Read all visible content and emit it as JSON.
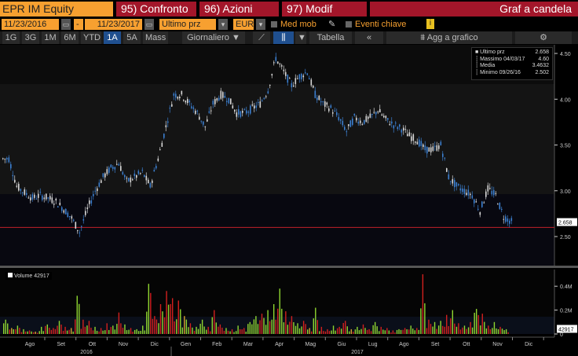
{
  "header": {
    "ticker": "EPR IM Equity",
    "compare": "95) Confronto",
    "actions": "96) Azioni",
    "modify": "97) Modif",
    "title": "Graf a candela"
  },
  "controls": {
    "start_date": "11/23/2016",
    "dash": "-",
    "end_date": "11/23/2017",
    "field": "Ultimo prz",
    "currency": "EUR",
    "moving_avg": "Med mob",
    "key_events": "Eventi chiave",
    "info": "i"
  },
  "toolbar": {
    "periods": [
      "1G",
      "3G",
      "1M",
      "6M",
      "YTD",
      "1A",
      "5A",
      "Mass"
    ],
    "active_period": "1A",
    "frequency": "Giornaliero ▼",
    "table": "Tabella",
    "collapse": "«",
    "add_to_chart": "Agg a grafico"
  },
  "legend": {
    "rows": [
      {
        "label": "Ultimo prz",
        "value": "2.658"
      },
      {
        "label": "Massimo 04/03/17",
        "value": "4.60"
      },
      {
        "label": "Media",
        "value": "3.4632"
      },
      {
        "label": "Minimo 09/26/16",
        "value": "2.502"
      }
    ]
  },
  "volume_legend": "Volume 42917",
  "colors": {
    "up": "#d8d8d8",
    "down": "#3b7fd0",
    "vol_up": "#8fd630",
    "vol_down": "#d2201e",
    "vol_mid": "#d8a030",
    "ref_line": "#c0202a"
  },
  "chart_data": [
    {
      "type": "candlestick",
      "title": "Graf a candela",
      "ylim": [
        2.3,
        4.6
      ],
      "yticks": [
        "4.50",
        "4.00",
        "3.50",
        "3.00",
        "2.50"
      ],
      "ytick_values": [
        4.5,
        4.0,
        3.5,
        3.0,
        2.5
      ],
      "last_price": "2.658",
      "ref_line": 2.6,
      "closes": [
        3.35,
        3.05,
        2.98,
        2.92,
        2.95,
        2.92,
        2.88,
        2.8,
        2.7,
        2.55,
        2.8,
        3.0,
        3.15,
        3.25,
        3.3,
        3.1,
        3.15,
        3.2,
        3.05,
        3.35,
        3.7,
        4.05,
        4.05,
        3.95,
        3.85,
        3.7,
        3.95,
        4.05,
        4.0,
        3.85,
        3.85,
        3.9,
        3.95,
        4.1,
        4.45,
        4.3,
        4.15,
        4.25,
        4.3,
        4.05,
        3.95,
        3.9,
        3.8,
        3.65,
        3.8,
        3.75,
        3.8,
        3.88,
        3.78,
        3.72,
        3.68,
        3.6,
        3.55,
        3.45,
        3.45,
        3.5,
        3.15,
        3.05,
        3.0,
        2.95,
        2.78,
        3.02,
        2.95,
        2.72,
        2.66
      ]
    },
    {
      "type": "bar",
      "title": "Volume",
      "ylim": [
        0,
        0.55
      ],
      "yticks": [
        "0.4M",
        "0.2M",
        "0"
      ],
      "ytick_values": [
        0.4,
        0.2,
        0
      ],
      "last_value": "42917",
      "values": [
        0.12,
        0.05,
        0.07,
        0.04,
        0.03,
        0.02,
        0.06,
        0.08,
        0.05,
        0.11,
        0.06,
        0.05,
        0.32,
        0.12,
        0.11,
        0.06,
        0.05,
        0.09,
        0.07,
        0.18,
        0.08,
        0.05,
        0.04,
        0.07,
        0.42,
        0.15,
        0.25,
        0.36,
        0.3,
        0.28,
        0.15,
        0.09,
        0.06,
        0.12,
        0.06,
        0.2,
        0.08,
        0.05,
        0.04,
        0.07,
        0.05,
        0.1,
        0.15,
        0.17,
        0.2,
        0.25,
        0.38,
        0.19,
        0.15,
        0.09,
        0.11,
        0.05,
        0.22,
        0.06,
        0.04,
        0.07,
        0.06,
        0.11,
        0.04,
        0.06,
        0.08,
        0.04,
        0.1,
        0.06,
        0.05,
        0.03,
        0.04,
        0.05,
        0.07,
        0.05,
        0.5,
        0.12,
        0.1,
        0.11,
        0.16,
        0.2,
        0.09,
        0.07,
        0.1,
        0.21,
        0.17,
        0.07,
        0.1,
        0.06,
        0.04
      ],
      "dirs": "guggruggrgrogrrgrrgrgrgggrrrrrorggrrrgrgrggrgggrrgrogrrgrrogrrgrrrgrgrrrggrgrgrgrrgrg"
    },
    {
      "type": "axis",
      "months": [
        "Ago",
        "Set",
        "Ott",
        "Nov",
        "Dic",
        "Gen",
        "Feb",
        "Mar",
        "Apr",
        "Mag",
        "Giu",
        "Lug",
        "Ago",
        "Set",
        "Ott",
        "Nov",
        "Dic"
      ],
      "years": [
        "2016",
        "2017"
      ]
    }
  ]
}
